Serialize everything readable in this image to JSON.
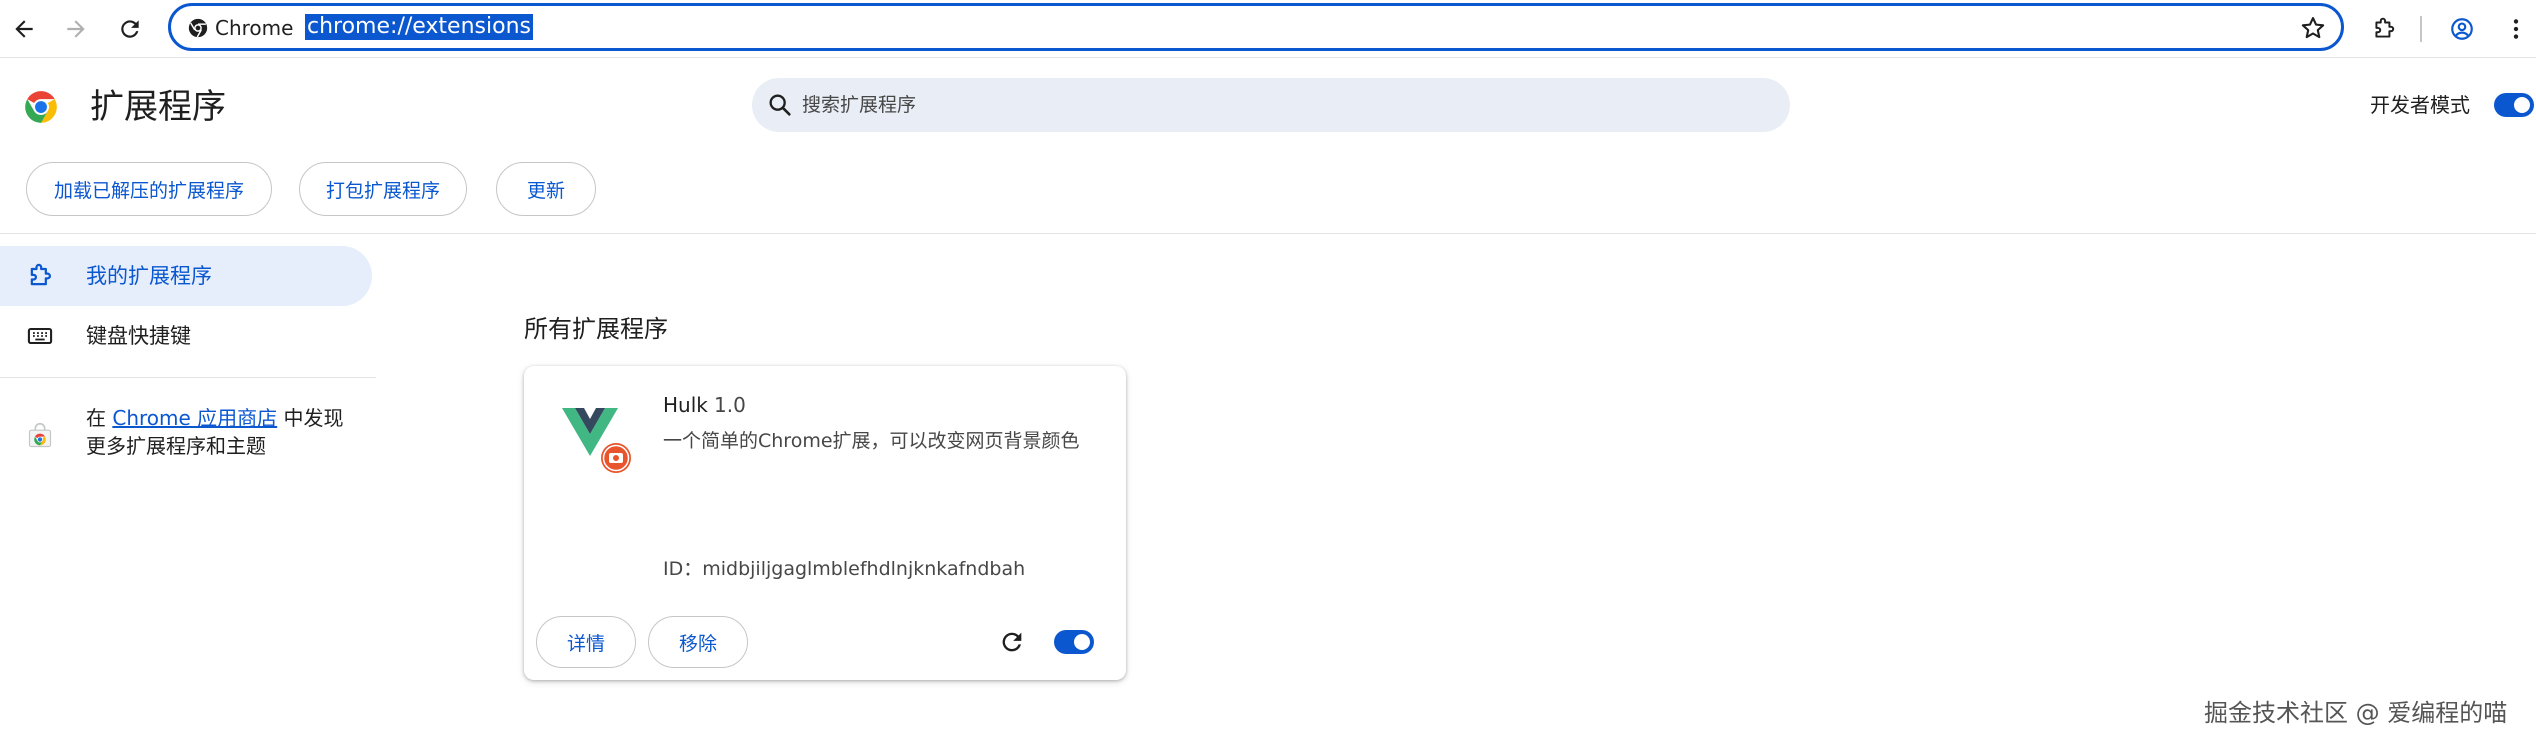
{
  "browser": {
    "site_label": "Chrome",
    "url": "chrome://extensions"
  },
  "header": {
    "title": "扩展程序",
    "search_placeholder": "搜索扩展程序",
    "dev_mode_label": "开发者模式",
    "dev_mode_on": true
  },
  "actions": {
    "load_unpacked": "加载已解压的扩展程序",
    "pack": "打包扩展程序",
    "update": "更新"
  },
  "sidebar": {
    "items": [
      {
        "label": "我的扩展程序",
        "icon": "puzzle-icon",
        "active": true
      },
      {
        "label": "键盘快捷键",
        "icon": "keyboard-icon",
        "active": false
      }
    ],
    "store_prefix": "在",
    "store_link": "Chrome 应用商店",
    "store_suffix": "中发现更多扩展程序和主题"
  },
  "main": {
    "section_title": "所有扩展程序",
    "extension": {
      "name": "Hulk",
      "version": "1.0",
      "description": "一个简单的Chrome扩展，可以改变网页背景颜色",
      "id_text": "ID：midbjiljgaglmblefhdlnjknkafndbah",
      "details_label": "详情",
      "remove_label": "移除",
      "enabled": true
    }
  },
  "watermark": "掘金技术社区 @ 爱编程的喵",
  "colors": {
    "accent": "#0b57d0",
    "active_bg": "#e6eefc",
    "search_bg": "#e9eef6"
  }
}
